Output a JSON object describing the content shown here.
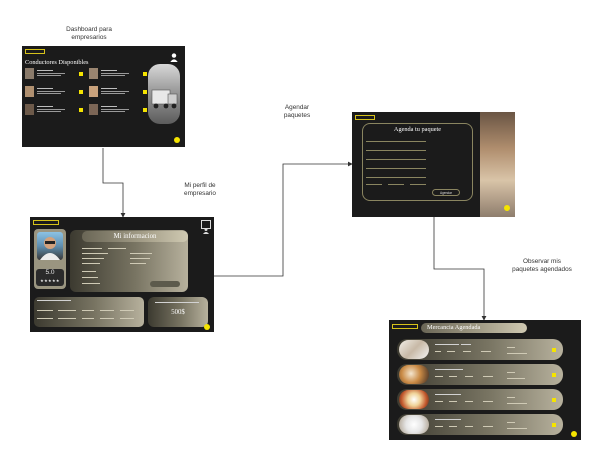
{
  "captions": {
    "dashboard": "Dashboard para empresarios",
    "perfil": "Mi perfil de empresario",
    "agendar": "Agendar paquetes",
    "observar": "Observar mis paquetes agendados"
  },
  "dashboard_screen": {
    "title": "Conductores Disponibles"
  },
  "perfil_screen": {
    "header": "Mi informacion",
    "rating": "5.0",
    "stars": "★★★★★",
    "amount": "500$"
  },
  "agendar_screen": {
    "title": "Agenda tu paquete",
    "button": "Agendar"
  },
  "mercancia_screen": {
    "title": "Mercancia Agendada"
  },
  "colors": {
    "accent": "#f5e400",
    "screen_bg": "#1b1b1b",
    "connector": "#333333"
  }
}
